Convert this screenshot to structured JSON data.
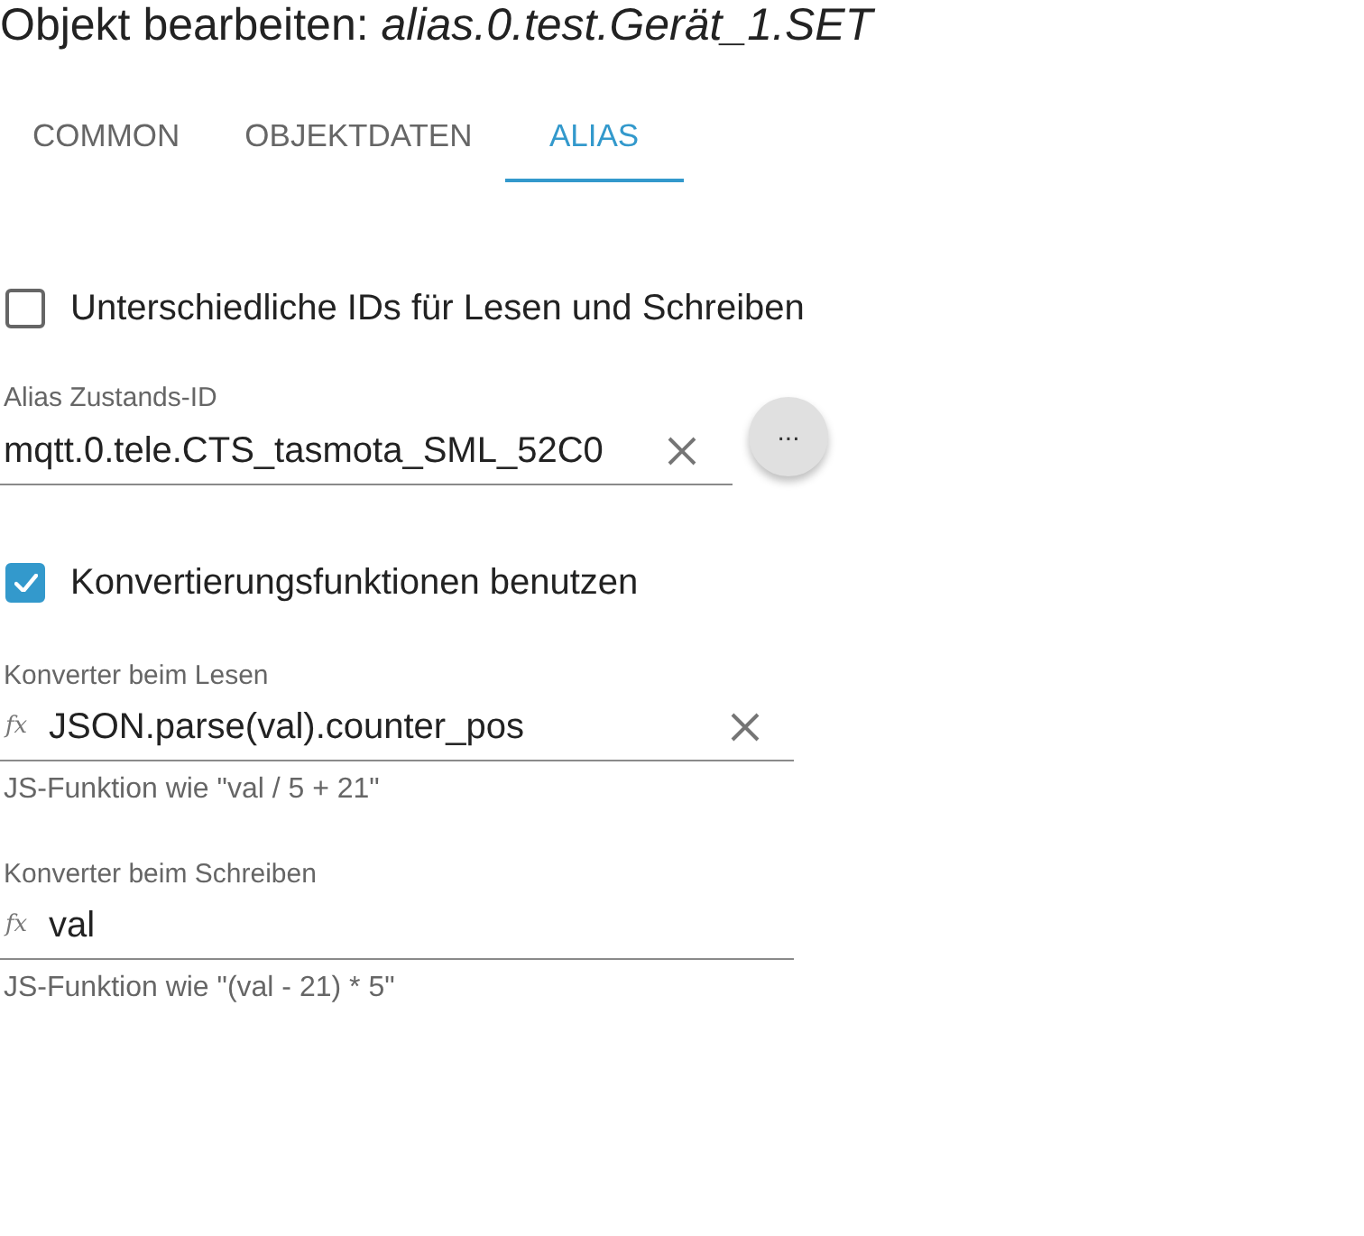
{
  "title": "Objekt bearbeiten: *alias.0.test.Gerät_1.SET*",
  "tabs": [
    {
      "label": "COMMON",
      "selected": false
    },
    {
      "label": "OBJEKTDATEN",
      "selected": false
    },
    {
      "label": "ALIAS",
      "selected": true
    }
  ],
  "controls": [
    {
      "kind": "checkbox",
      "label": "Unterschiedliche IDs für Lesen und Schreiben",
      "checked": false
    },
    {
      "kind": "id_field",
      "label": "Alias Zustands-ID",
      "value": "mqtt.0.tele.CTS_tasmota_SML_52C0",
      "clearable": true,
      "button": "..."
    },
    {
      "kind": "checkbox",
      "label": "Konvertierungsfunktionen benutzen",
      "checked": true
    },
    {
      "kind": "function_field",
      "label": "Konverter beim Lesen",
      "prefix": "fx",
      "value": "JSON.parse(val).counter_pos",
      "clearable": true,
      "helper": "JS-Funktion wie \"val / 5 + 21\""
    },
    {
      "kind": "function_field",
      "label": "Konverter beim Schreiben",
      "prefix": "fx",
      "value": "val",
      "clearable": false,
      "helper": "JS-Funktion wie \"(val - 21) * 5\""
    }
  ]
}
